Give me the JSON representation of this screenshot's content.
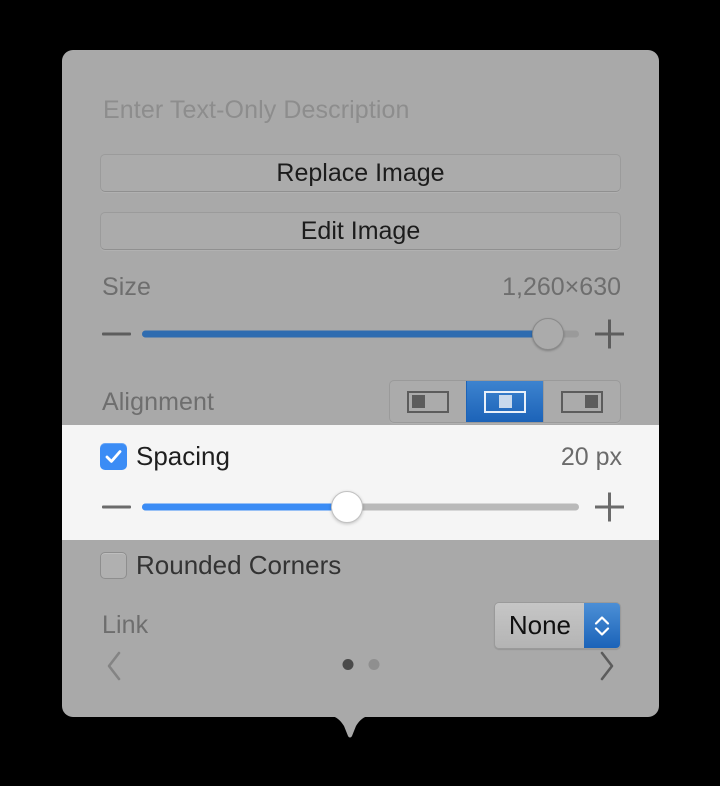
{
  "panel": {
    "type": "popover",
    "background_color": "#a9a9a9",
    "accent_color": "#3b8cf5",
    "accent_color_dim": "#2f6cb0",
    "highlight_band_color": "#f5f5f5"
  },
  "description": {
    "placeholder": "Enter Text-Only Description",
    "value": ""
  },
  "buttons": {
    "replace_image": "Replace Image",
    "edit_image": "Edit Image"
  },
  "size": {
    "label": "Size",
    "value": "1,260×630",
    "slider": {
      "percent": 93,
      "minus_icon": "minus-icon",
      "plus_icon": "plus-icon"
    }
  },
  "alignment": {
    "label": "Alignment",
    "options": [
      {
        "name": "align-left",
        "icon": "align-left-icon",
        "selected": false
      },
      {
        "name": "align-center",
        "icon": "align-center-icon",
        "selected": true
      },
      {
        "name": "align-right",
        "icon": "align-right-icon",
        "selected": false
      }
    ]
  },
  "spacing": {
    "label": "Spacing",
    "checked": true,
    "checkbox_icon": "checkmark-icon",
    "value": "20 px",
    "slider": {
      "percent": 47,
      "minus_icon": "minus-icon",
      "plus_icon": "plus-icon"
    }
  },
  "rounded_corners": {
    "label": "Rounded Corners",
    "checked": false
  },
  "link": {
    "label": "Link",
    "selected_option": "None",
    "options": [
      "None"
    ],
    "stepper_icon": "chevron-up-down-icon"
  },
  "pager": {
    "prev_icon": "chevron-left-icon",
    "next_icon": "chevron-right-icon",
    "page_count": 2,
    "current_page": 1
  }
}
